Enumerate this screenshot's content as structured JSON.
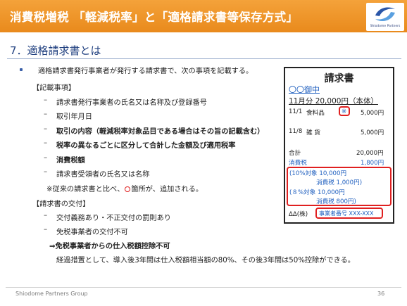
{
  "header": {
    "title": "消費税増税 「軽減税率」と「適格請求書等保存方式」"
  },
  "logo": {
    "text": "Shiodome Partners"
  },
  "section": {
    "title": "7．適格請求書とは"
  },
  "intro": "適格請求書発行事業者が発行する請求書で、次の事項を記載する。",
  "items_heading": "【記載事項】",
  "items": [
    "請求書発行事業者の氏名又は名称及び登録番号",
    "取引年月日",
    "取引の内容（軽減税率対象品目である場合はその旨の記載含む）",
    "税率の異なるごとに区分して合計した金額及び適用税率",
    "消費税額",
    "請求書受領者の氏名又は名称"
  ],
  "note_before": "※従来の請求書と比べ、",
  "note_after": "箇所が、追加される。",
  "delivery_heading": "【請求書の交付】",
  "delivery_items": [
    "交付義務あり・不正交付の罰則あり",
    "免税事業者の交付不可"
  ],
  "consequence": "⇒免税事業者からの仕入税額控除不可",
  "transition": "経過措置として、導入後3年間は仕入税額相当額の80%、その後3年間は50%控除ができる。",
  "invoice": {
    "title": "請求書",
    "addressee": "〇〇御中",
    "summary": "11月分 20,000円（本体）",
    "row1_date": "11/1",
    "row1_item": "食料品",
    "row1_mark": "※",
    "row1_amount": "5,000円",
    "row2_date": "11/8",
    "row2_item": "雑 貨",
    "row2_amount": "5,000円",
    "total_label": "合計",
    "total_amount": "20,000円",
    "tax_label": "消費税",
    "tax_amount": "1,800円",
    "b10_label": "(10%対象 10,000円",
    "b10_tax": "消費税 1,000円)",
    "b8_label": "(８%対象 10,000円",
    "b8_tax": "消費税 800円)",
    "issuer": "ΔΔ(株)",
    "reg_no": "事業者番号 XXX-XXX"
  },
  "footer": {
    "company": "Shiodome Partners Group",
    "page": "36"
  }
}
